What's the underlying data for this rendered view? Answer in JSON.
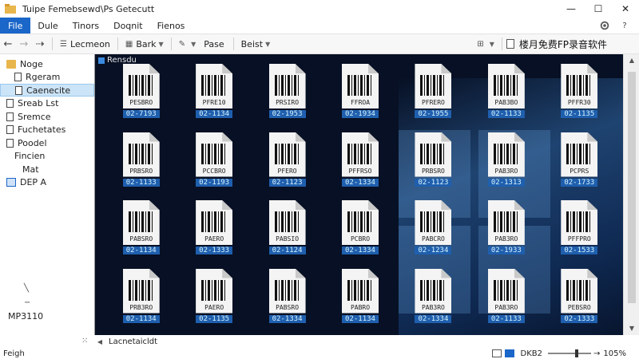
{
  "window": {
    "title": "Tuipe Femebsewd\\Ps Getecutt",
    "minimize_glyph": "—",
    "maximize_glyph": "☐",
    "close_glyph": "✕"
  },
  "menu": {
    "items": [
      "File",
      "Dule",
      "Tinors",
      "Doqnit",
      "Fienos"
    ],
    "settings_icon": "gear-icon",
    "help_icon": "help-icon",
    "help_glyph": "?"
  },
  "toolbar": {
    "back_glyph": "←",
    "forward_glyph": "→",
    "up_glyph": "⇢",
    "location_label": "Lecmeon",
    "back_label": "Bark",
    "pase_label": "Pase",
    "beist_label": "Beist",
    "right_title": "楼月免费FP录音软件"
  },
  "sidebar": {
    "items": [
      {
        "label": "Noge",
        "icon": "folder-icon"
      },
      {
        "label": "Rgeram",
        "icon": "document-icon"
      },
      {
        "label": "Caenecite",
        "icon": "document-icon",
        "selected": true
      },
      {
        "label": "Sreab Lst",
        "icon": "document-icon"
      },
      {
        "label": "Sremce",
        "icon": "document-icon"
      },
      {
        "label": "Fuchetates",
        "icon": "document-icon"
      },
      {
        "label": "Poodel",
        "icon": "document-icon"
      },
      {
        "label": "Fincien",
        "icon": "none"
      },
      {
        "label": "Mat",
        "icon": "none"
      },
      {
        "label": "DEP A",
        "icon": "drive-icon"
      }
    ],
    "footer_label": "MP3110"
  },
  "main": {
    "header_label": "Rensdu",
    "files": [
      {
        "page": "PESBRO",
        "caption": "02-7193"
      },
      {
        "page": "PFRE10",
        "caption": "02-1134"
      },
      {
        "page": "PRSIRO",
        "caption": "02-1953"
      },
      {
        "page": "FFROA",
        "caption": "02-1934"
      },
      {
        "page": "PFRERO",
        "caption": "02-1955"
      },
      {
        "page": "PAB3BO",
        "caption": "02-1133"
      },
      {
        "page": "PFFR30",
        "caption": "02-1135"
      },
      {
        "page": "PRBSRO",
        "caption": "02-1133"
      },
      {
        "page": "PCCBRO",
        "caption": "02-1193"
      },
      {
        "page": "PFERO",
        "caption": "02-1123"
      },
      {
        "page": "PFFRSO",
        "caption": "02-1334"
      },
      {
        "page": "PRBSRO",
        "caption": "02-1123"
      },
      {
        "page": "PAB3RO",
        "caption": "02-1313"
      },
      {
        "page": "PCPRS",
        "caption": "02-1733"
      },
      {
        "page": "PABSRO",
        "caption": "02-1134"
      },
      {
        "page": "PAERO",
        "caption": "02-1333"
      },
      {
        "page": "PABSIO",
        "caption": "02-1124"
      },
      {
        "page": "PCBRO",
        "caption": "02-1334"
      },
      {
        "page": "PABCRO",
        "caption": "02-1234"
      },
      {
        "page": "PAB3RO",
        "caption": "02-1933"
      },
      {
        "page": "PFFPRO",
        "caption": "02-1533"
      },
      {
        "page": "PRB3RO",
        "caption": "02-1134"
      },
      {
        "page": "PAERO",
        "caption": "02-1135"
      },
      {
        "page": "PABSRO",
        "caption": "02-1334"
      },
      {
        "page": "PABRO",
        "caption": "02-1134"
      },
      {
        "page": "PAB3RO",
        "caption": "02-1334"
      },
      {
        "page": "PAB3RO",
        "caption": "02-1133"
      },
      {
        "page": "PEBSRO",
        "caption": "02-1333"
      }
    ]
  },
  "statusbar": {
    "left_label": "Feigh",
    "path_label": "Lacnetaicldt",
    "zoom_label": "DKB2",
    "zoom_percent": "105%"
  }
}
